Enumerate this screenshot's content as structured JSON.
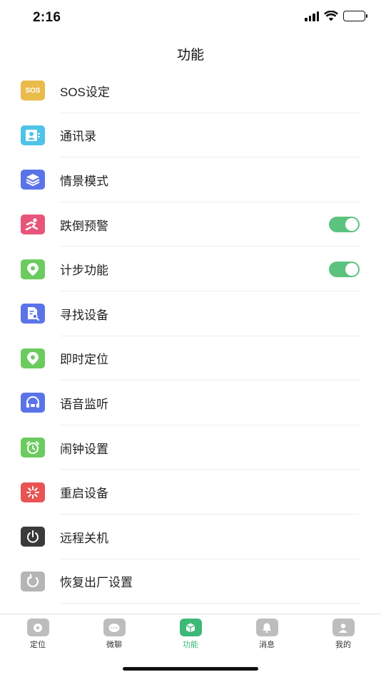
{
  "status_bar": {
    "time": "2:16"
  },
  "header": {
    "title": "功能"
  },
  "menu": [
    {
      "label": "SOS设定",
      "icon": "sos-icon",
      "color": "#e9bb4a",
      "icon_text": "SOS"
    },
    {
      "label": "通讯录",
      "icon": "contacts-icon",
      "color": "#4fc3e8"
    },
    {
      "label": "情景模式",
      "icon": "layers-icon",
      "color": "#5a74e8"
    },
    {
      "label": "跌倒预警",
      "icon": "fall-alert-icon",
      "color": "#e8557a",
      "toggle_on": true
    },
    {
      "label": "计步功能",
      "icon": "location-pin-icon",
      "color": "#6ccb5f",
      "toggle_on": true
    },
    {
      "label": "寻找设备",
      "icon": "search-document-icon",
      "color": "#5a74e8"
    },
    {
      "label": "即时定位",
      "icon": "location-pin-icon",
      "color": "#6ccb5f"
    },
    {
      "label": "语音监听",
      "icon": "headset-icon",
      "color": "#5a74e8"
    },
    {
      "label": "闹钟设置",
      "icon": "alarm-clock-icon",
      "color": "#6ccb5f"
    },
    {
      "label": "重启设备",
      "icon": "restart-icon",
      "color": "#e85454"
    },
    {
      "label": "远程关机",
      "icon": "power-icon",
      "color": "#3a3a3a"
    },
    {
      "label": "恢复出厂设置",
      "icon": "factory-reset-icon",
      "color": "#b5b5b5"
    }
  ],
  "tabs": [
    {
      "label": "定位",
      "icon": "location-icon",
      "active": false
    },
    {
      "label": "微聊",
      "icon": "chat-icon",
      "active": false
    },
    {
      "label": "功能",
      "icon": "function-icon",
      "active": true
    },
    {
      "label": "消息",
      "icon": "bell-icon",
      "active": false
    },
    {
      "label": "我的",
      "icon": "profile-icon",
      "active": false
    }
  ],
  "colors": {
    "accent": "#3cb878",
    "toggle": "#5cc37e",
    "divider": "#ededed"
  }
}
